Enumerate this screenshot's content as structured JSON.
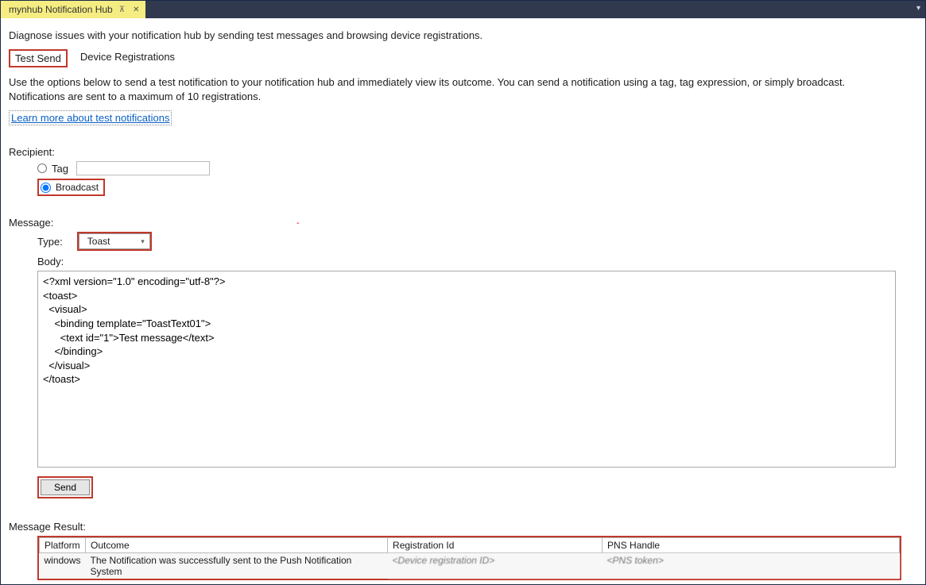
{
  "titlebar": {
    "tab_title": "mynhub Notification Hub"
  },
  "intro": "Diagnose issues with your notification hub by sending test messages and browsing device registrations.",
  "subtabs": {
    "test_send": "Test Send",
    "device_regs": "Device Registrations"
  },
  "desc": "Use the options below to send a test notification to your notification hub and immediately view its outcome. You can send a notification using a tag, tag expression, or simply broadcast. Notifications are sent to a maximum of 10 registrations.",
  "learn_link": "Learn more about test notifications",
  "recipient": {
    "label": "Recipient:",
    "tag_label": "Tag",
    "tag_value": "",
    "broadcast_label": "Broadcast",
    "selected": "broadcast"
  },
  "message": {
    "label": "Message:",
    "type_label": "Type:",
    "type_value": "Toast",
    "body_label": "Body:",
    "body_value": "<?xml version=\"1.0\" encoding=\"utf-8\"?>\n<toast>\n  <visual>\n    <binding template=\"ToastText01\">\n      <text id=\"1\">Test message</text>\n    </binding>\n  </visual>\n</toast>"
  },
  "send_label": "Send",
  "result": {
    "label": "Message Result:",
    "headers": {
      "platform": "Platform",
      "outcome": "Outcome",
      "regid": "Registration Id",
      "pns": "PNS Handle"
    },
    "row": {
      "platform": "windows",
      "outcome": "The Notification was successfully sent to the Push Notification System",
      "regid": "<Device registration ID>",
      "pns": "<PNS token>"
    }
  }
}
